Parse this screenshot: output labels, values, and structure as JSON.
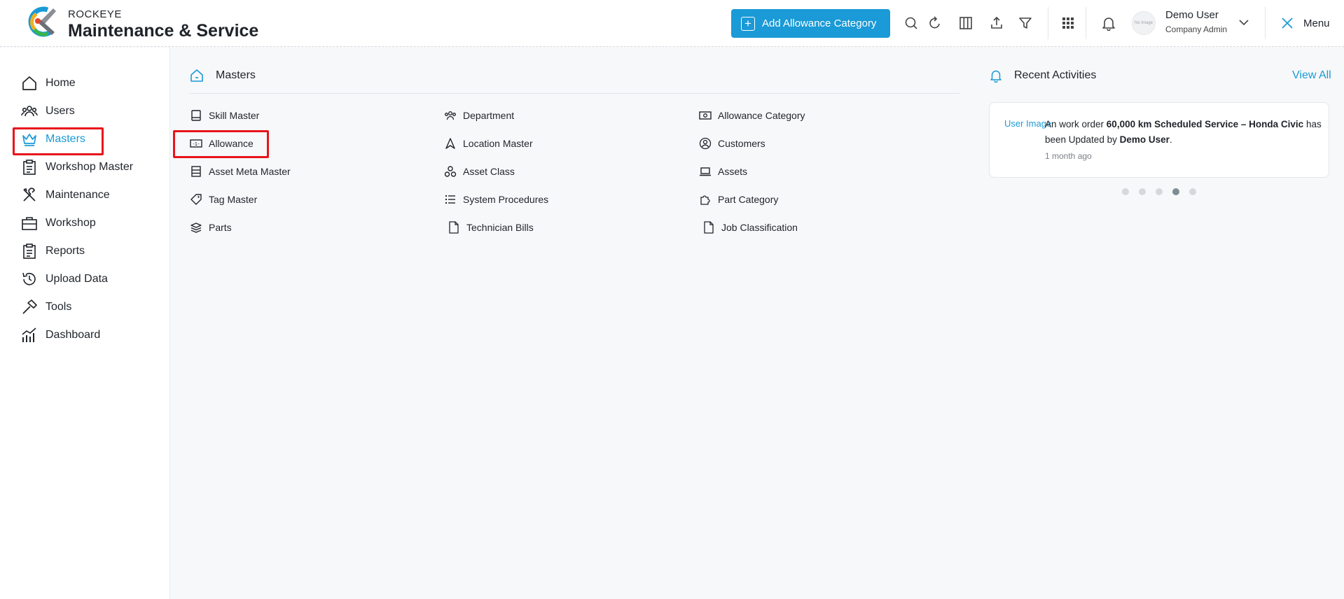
{
  "header": {
    "brand_small": "ROCKEYE",
    "brand_big": "Maintenance & Service",
    "add_button_label": "Add Allowance Category",
    "user_name": "Demo User",
    "user_role": "Company Admin",
    "avatar_text": "No Image",
    "menu_label": "Menu"
  },
  "sidebar": {
    "items": [
      {
        "label": "Home",
        "icon": "home-icon"
      },
      {
        "label": "Users",
        "icon": "users-icon"
      },
      {
        "label": "Masters",
        "icon": "crown-icon",
        "active": true
      },
      {
        "label": "Workshop Master",
        "icon": "clipboard-icon"
      },
      {
        "label": "Maintenance",
        "icon": "tools-icon"
      },
      {
        "label": "Workshop",
        "icon": "briefcase-icon"
      },
      {
        "label": "Reports",
        "icon": "clipboard-icon"
      },
      {
        "label": "Upload Data",
        "icon": "history-icon"
      },
      {
        "label": "Tools",
        "icon": "hammer-icon"
      },
      {
        "label": "Dashboard",
        "icon": "chart-icon"
      }
    ]
  },
  "masters": {
    "title": "Masters",
    "col1": [
      "Skill Master",
      "Allowance",
      "Asset Meta Master",
      "Tag Master",
      "Parts"
    ],
    "col2": [
      "Department",
      "Location Master",
      "Asset Class",
      "System Procedures",
      "Technician Bills"
    ],
    "col3": [
      "Allowance Category",
      "Customers",
      "Assets",
      "Part Category",
      "Job Classification"
    ]
  },
  "recent": {
    "title": "Recent Activities",
    "view_all": "View All",
    "img_alt": "User Image",
    "prefix": "An work order ",
    "subject": "60,000 km Scheduled Service – Honda Civic",
    "middle": " has been Updated by ",
    "actor": "Demo User",
    "suffix": ".",
    "time": "1 month ago",
    "dots_total": 5,
    "dots_active": 4
  },
  "colors": {
    "accent": "#1a9ad6",
    "highlight": "#e8141c"
  }
}
